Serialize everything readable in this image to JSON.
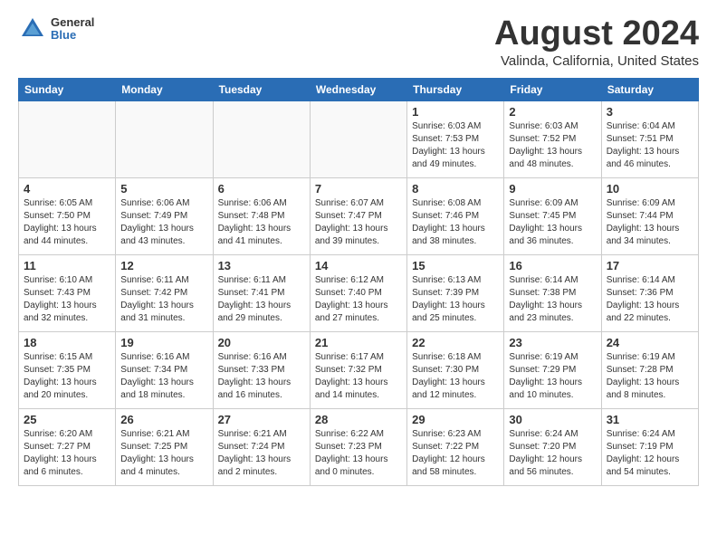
{
  "header": {
    "logo_general": "General",
    "logo_blue": "Blue",
    "month_title": "August 2024",
    "location": "Valinda, California, United States"
  },
  "calendar": {
    "days_of_week": [
      "Sunday",
      "Monday",
      "Tuesday",
      "Wednesday",
      "Thursday",
      "Friday",
      "Saturday"
    ],
    "weeks": [
      [
        {
          "day": "",
          "info": ""
        },
        {
          "day": "",
          "info": ""
        },
        {
          "day": "",
          "info": ""
        },
        {
          "day": "",
          "info": ""
        },
        {
          "day": "1",
          "info": "Sunrise: 6:03 AM\nSunset: 7:53 PM\nDaylight: 13 hours\nand 49 minutes."
        },
        {
          "day": "2",
          "info": "Sunrise: 6:03 AM\nSunset: 7:52 PM\nDaylight: 13 hours\nand 48 minutes."
        },
        {
          "day": "3",
          "info": "Sunrise: 6:04 AM\nSunset: 7:51 PM\nDaylight: 13 hours\nand 46 minutes."
        }
      ],
      [
        {
          "day": "4",
          "info": "Sunrise: 6:05 AM\nSunset: 7:50 PM\nDaylight: 13 hours\nand 44 minutes."
        },
        {
          "day": "5",
          "info": "Sunrise: 6:06 AM\nSunset: 7:49 PM\nDaylight: 13 hours\nand 43 minutes."
        },
        {
          "day": "6",
          "info": "Sunrise: 6:06 AM\nSunset: 7:48 PM\nDaylight: 13 hours\nand 41 minutes."
        },
        {
          "day": "7",
          "info": "Sunrise: 6:07 AM\nSunset: 7:47 PM\nDaylight: 13 hours\nand 39 minutes."
        },
        {
          "day": "8",
          "info": "Sunrise: 6:08 AM\nSunset: 7:46 PM\nDaylight: 13 hours\nand 38 minutes."
        },
        {
          "day": "9",
          "info": "Sunrise: 6:09 AM\nSunset: 7:45 PM\nDaylight: 13 hours\nand 36 minutes."
        },
        {
          "day": "10",
          "info": "Sunrise: 6:09 AM\nSunset: 7:44 PM\nDaylight: 13 hours\nand 34 minutes."
        }
      ],
      [
        {
          "day": "11",
          "info": "Sunrise: 6:10 AM\nSunset: 7:43 PM\nDaylight: 13 hours\nand 32 minutes."
        },
        {
          "day": "12",
          "info": "Sunrise: 6:11 AM\nSunset: 7:42 PM\nDaylight: 13 hours\nand 31 minutes."
        },
        {
          "day": "13",
          "info": "Sunrise: 6:11 AM\nSunset: 7:41 PM\nDaylight: 13 hours\nand 29 minutes."
        },
        {
          "day": "14",
          "info": "Sunrise: 6:12 AM\nSunset: 7:40 PM\nDaylight: 13 hours\nand 27 minutes."
        },
        {
          "day": "15",
          "info": "Sunrise: 6:13 AM\nSunset: 7:39 PM\nDaylight: 13 hours\nand 25 minutes."
        },
        {
          "day": "16",
          "info": "Sunrise: 6:14 AM\nSunset: 7:38 PM\nDaylight: 13 hours\nand 23 minutes."
        },
        {
          "day": "17",
          "info": "Sunrise: 6:14 AM\nSunset: 7:36 PM\nDaylight: 13 hours\nand 22 minutes."
        }
      ],
      [
        {
          "day": "18",
          "info": "Sunrise: 6:15 AM\nSunset: 7:35 PM\nDaylight: 13 hours\nand 20 minutes."
        },
        {
          "day": "19",
          "info": "Sunrise: 6:16 AM\nSunset: 7:34 PM\nDaylight: 13 hours\nand 18 minutes."
        },
        {
          "day": "20",
          "info": "Sunrise: 6:16 AM\nSunset: 7:33 PM\nDaylight: 13 hours\nand 16 minutes."
        },
        {
          "day": "21",
          "info": "Sunrise: 6:17 AM\nSunset: 7:32 PM\nDaylight: 13 hours\nand 14 minutes."
        },
        {
          "day": "22",
          "info": "Sunrise: 6:18 AM\nSunset: 7:30 PM\nDaylight: 13 hours\nand 12 minutes."
        },
        {
          "day": "23",
          "info": "Sunrise: 6:19 AM\nSunset: 7:29 PM\nDaylight: 13 hours\nand 10 minutes."
        },
        {
          "day": "24",
          "info": "Sunrise: 6:19 AM\nSunset: 7:28 PM\nDaylight: 13 hours\nand 8 minutes."
        }
      ],
      [
        {
          "day": "25",
          "info": "Sunrise: 6:20 AM\nSunset: 7:27 PM\nDaylight: 13 hours\nand 6 minutes."
        },
        {
          "day": "26",
          "info": "Sunrise: 6:21 AM\nSunset: 7:25 PM\nDaylight: 13 hours\nand 4 minutes."
        },
        {
          "day": "27",
          "info": "Sunrise: 6:21 AM\nSunset: 7:24 PM\nDaylight: 13 hours\nand 2 minutes."
        },
        {
          "day": "28",
          "info": "Sunrise: 6:22 AM\nSunset: 7:23 PM\nDaylight: 13 hours\nand 0 minutes."
        },
        {
          "day": "29",
          "info": "Sunrise: 6:23 AM\nSunset: 7:22 PM\nDaylight: 12 hours\nand 58 minutes."
        },
        {
          "day": "30",
          "info": "Sunrise: 6:24 AM\nSunset: 7:20 PM\nDaylight: 12 hours\nand 56 minutes."
        },
        {
          "day": "31",
          "info": "Sunrise: 6:24 AM\nSunset: 7:19 PM\nDaylight: 12 hours\nand 54 minutes."
        }
      ]
    ]
  }
}
